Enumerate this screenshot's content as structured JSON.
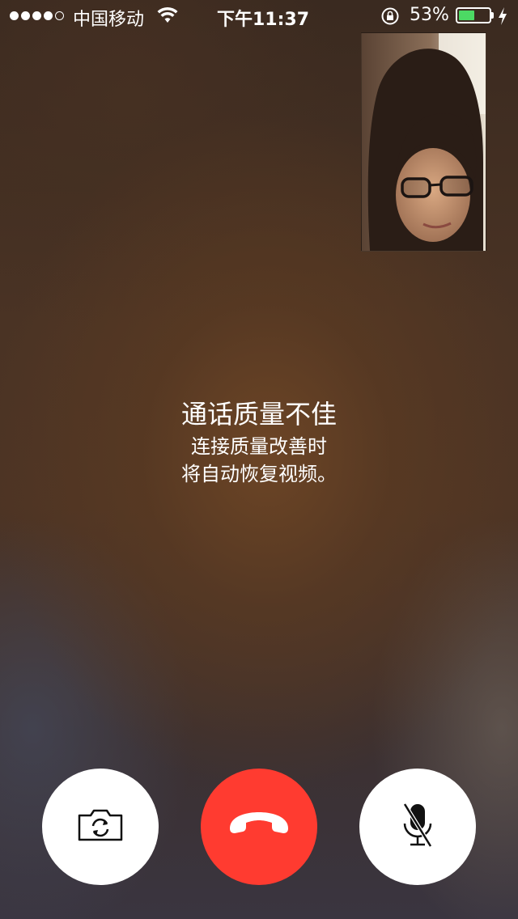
{
  "status_bar": {
    "signal_strength": "4 of 5",
    "carrier": "中国移动",
    "time": "下午11:37",
    "battery_percent": "53%",
    "battery_level": 0.53,
    "icons": [
      "signal-dots",
      "wifi-icon",
      "rotation-lock-icon",
      "battery-icon",
      "charging-icon"
    ]
  },
  "call": {
    "self_view": "self-view-video",
    "message_title": "通话质量不佳",
    "message_line1": "连接质量改善时",
    "message_line2": "将自动恢复视频。"
  },
  "controls": {
    "flip_camera_icon": "camera-flip-icon",
    "end_call_icon": "end-call-icon",
    "mute_icon": "microphone-muted-icon"
  },
  "colors": {
    "end_call": "#ff3b30",
    "battery_fill": "#4cd964",
    "button_background": "#ffffff"
  }
}
